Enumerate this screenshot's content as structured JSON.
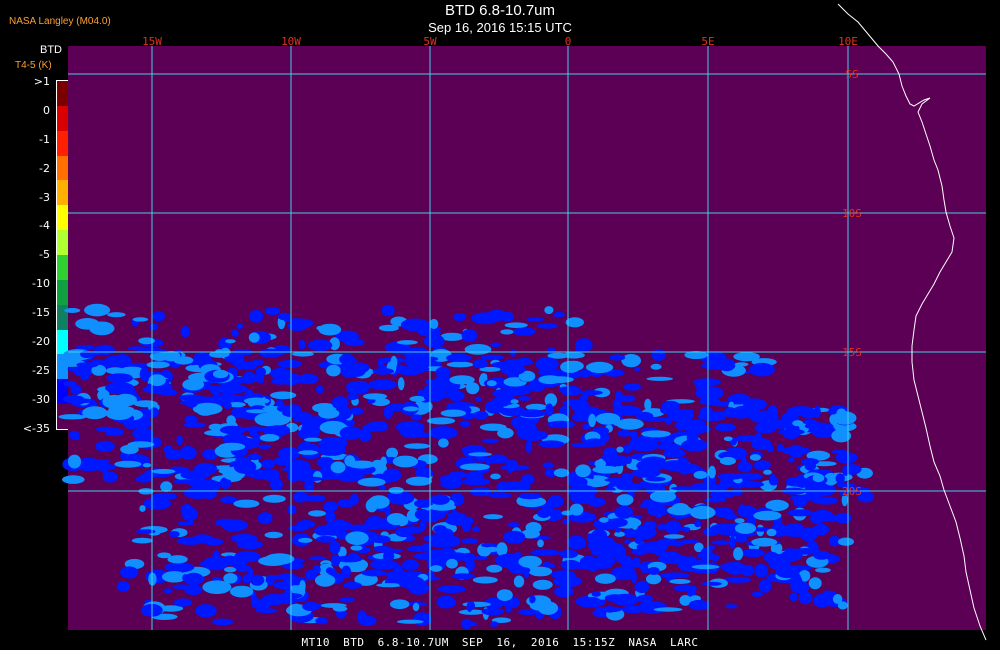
{
  "header": {
    "credit": "NASA Langley (M04.0)",
    "title": "BTD 6.8-10.7um",
    "subtitle": "Sep 16, 2016 15:15 UTC"
  },
  "colorbar": {
    "title": "BTD",
    "unit": "T4-5 (K)",
    "ticks": [
      ">1",
      "0",
      "-1",
      "-2",
      "-3",
      "-4",
      "-5",
      "-10",
      "-15",
      "-20",
      "-25",
      "-30",
      "<-35"
    ],
    "colors": [
      "#7a0000",
      "#d80000",
      "#ff2000",
      "#ff7000",
      "#ffb000",
      "#ffff00",
      "#b0ff30",
      "#30d030",
      "#10a040",
      "#108060",
      "#00ffff",
      "#1090ff",
      "#0000ff",
      "#5b0055"
    ]
  },
  "map": {
    "background_color": "#5b0055",
    "grid_color": "#40d0e8",
    "lon_labels": [
      "15W",
      "10W",
      "5W",
      "0",
      "5E",
      "10E"
    ],
    "lat_labels": [
      "5S",
      "10S",
      "15S",
      "20S"
    ],
    "lon_label_color": "#e03020",
    "lat_label_color": "#e03020"
  },
  "footer": {
    "text": "MT10 BTD 6.8-10.7UM SEP 16, 2016 15:15Z NASA LARC"
  }
}
